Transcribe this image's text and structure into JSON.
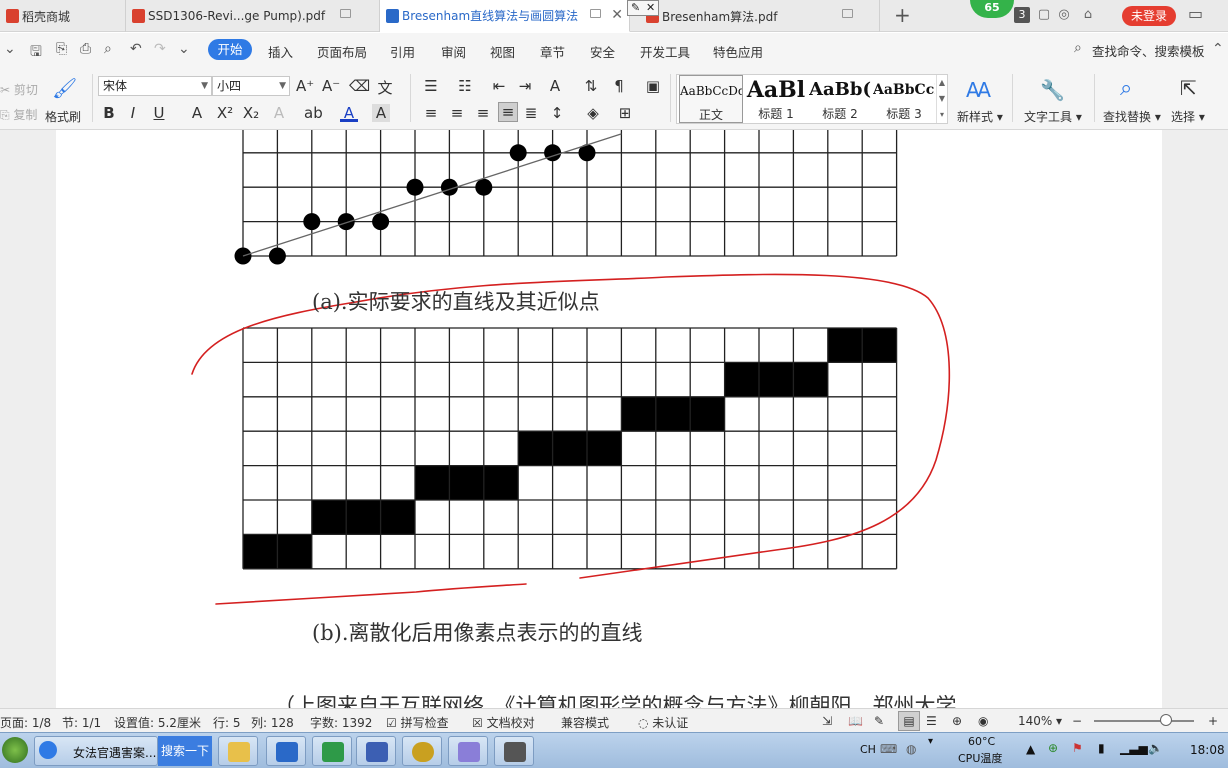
{
  "tabs": [
    {
      "label": "稻壳商城",
      "color": "#d9412f"
    },
    {
      "label": "SSD1306-Revi...ge Pump).pdf",
      "color": "#d9412f"
    },
    {
      "label": "Bresenham直线算法与画圆算法",
      "color": "#2a69c8",
      "active": true
    },
    {
      "label": "Bresenham算法.pdf",
      "color": "#d9412f"
    }
  ],
  "titlebar": {
    "badge": "65",
    "window_count": "3",
    "login_label": "未登录",
    "login_color": "#e53d30"
  },
  "menu": {
    "items": [
      "开始",
      "插入",
      "页面布局",
      "引用",
      "审阅",
      "视图",
      "章节",
      "安全",
      "开发工具",
      "特色应用"
    ],
    "search_command": "查找命令、搜索模板",
    "accent": "#2f7ae5"
  },
  "ribbon": {
    "cut": "剪切",
    "copy": "复制",
    "format_painter": "格式刷",
    "font_name": "宋体",
    "font_size": "小四",
    "styles": [
      {
        "preview": "AaBbCcDd",
        "label": "正文"
      },
      {
        "preview": "AaBl",
        "label": "标题 1"
      },
      {
        "preview": "AaBb(",
        "label": "标题 2"
      },
      {
        "preview": "AaBbCcI",
        "label": "标题 3"
      }
    ],
    "new_style": "新样式",
    "text_tools": "文字工具",
    "find_replace": "查找替换",
    "select": "选择"
  },
  "document": {
    "caption_a": "(a).实际要求的直线及其近似点",
    "caption_b": "(b).离散化后用像素点表示的的直线",
    "partial_line": "（上图来自于互联网络，《计算机图形学的概念与方法》柳朝阳，郑州大学",
    "grid_color": "#222222",
    "annotation_color": "#d42020",
    "points_a": [
      [
        0,
        0
      ],
      [
        1,
        0
      ],
      [
        2,
        1
      ],
      [
        3,
        1
      ],
      [
        4,
        1
      ],
      [
        5,
        2
      ],
      [
        6,
        2
      ],
      [
        7,
        2
      ],
      [
        8,
        3
      ],
      [
        9,
        3
      ],
      [
        10,
        3
      ]
    ],
    "pixels_b": [
      [
        0,
        0
      ],
      [
        1,
        0
      ],
      [
        2,
        1
      ],
      [
        3,
        1
      ],
      [
        4,
        1
      ],
      [
        5,
        2
      ],
      [
        6,
        2
      ],
      [
        7,
        2
      ],
      [
        8,
        3
      ],
      [
        9,
        3
      ],
      [
        10,
        3
      ],
      [
        11,
        4
      ],
      [
        12,
        4
      ],
      [
        13,
        4
      ],
      [
        14,
        5
      ],
      [
        15,
        5
      ],
      [
        16,
        5
      ],
      [
        17,
        6
      ],
      [
        18,
        6
      ]
    ]
  },
  "status": {
    "page": "页面: 1/8",
    "section": "节: 1/1",
    "setting": "设置值: 5.2厘米",
    "row": "行: 5",
    "col": "列: 128",
    "wordcount": "字数: 1392",
    "spell": "拼写检查",
    "proof": "文档校对",
    "compat": "兼容模式",
    "auth": "未认证",
    "zoom": "140%"
  },
  "taskbar": {
    "ie_task": "女法官遇害案...",
    "search_btn": "搜索一下",
    "lang": "CH",
    "temp": "60°C",
    "temp_label": "CPU温度",
    "clock": "18:08"
  }
}
